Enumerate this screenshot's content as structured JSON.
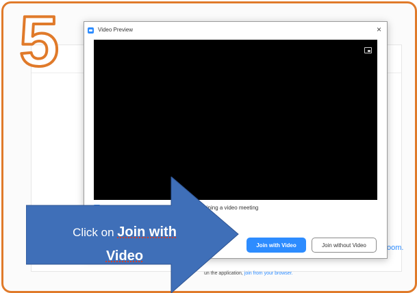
{
  "step": {
    "number": "5"
  },
  "dialog": {
    "title": "Video Preview",
    "close_glyph": "×",
    "checkbox_label": "Always show video preview dialog when joining a video meeting",
    "join_with_video": "Join with Video",
    "join_without_video": "Join without Video"
  },
  "background": {
    "side_text": "oom.",
    "bottom_text_before": "un the application,",
    "bottom_link": "join from your browser."
  },
  "callout": {
    "prefix": "Click on",
    "bold_line1": "Join with",
    "bold_line2": "Video"
  },
  "colors": {
    "frame": "#e07a2a",
    "accent": "#2d8cff",
    "callout": "#3f6fb8"
  },
  "icons": [
    "app-icon",
    "picture-in-picture-icon",
    "close-icon",
    "checkbox-checked-icon",
    "arrow-callout"
  ]
}
